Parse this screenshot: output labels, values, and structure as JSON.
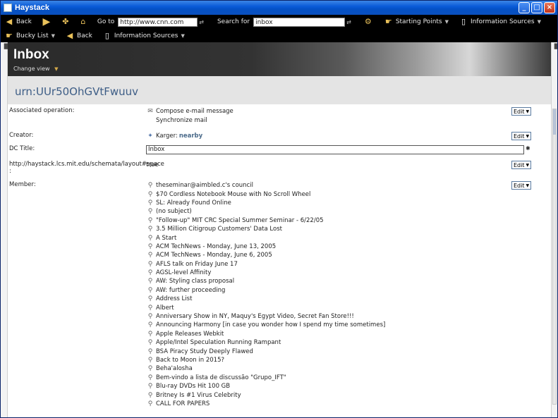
{
  "window": {
    "title": "Haystack"
  },
  "window_controls": {
    "minimize": "_",
    "maximize": "□",
    "close": "×"
  },
  "toolbar1": {
    "back": "Back",
    "go_to_label": "Go to",
    "go_to_value": "http://www.cnn.com",
    "search_label": "Search for",
    "search_value": "inbox",
    "starting_points": "Starting Points",
    "information_sources": "Information Sources"
  },
  "toolbar2": {
    "bucky_list": "Bucky List",
    "back": "Back",
    "information_sources": "Information Sources"
  },
  "header": {
    "title": "Inbox",
    "change_view": "Change view"
  },
  "urn": "urn:UUr50OhGVtFwuuv",
  "properties": {
    "associated_operation": {
      "label": "Associated operation:",
      "values": [
        "Compose e-mail message",
        "Synchronize mail"
      ],
      "edit": "Edit"
    },
    "creator": {
      "label": "Creator:",
      "value_prefix": "Karger: ",
      "value_name": "nearby",
      "edit": "Edit"
    },
    "dc_title": {
      "label": "DC Title:",
      "value": "Inbox"
    },
    "layout_space": {
      "label": "http://haystack.lcs.mit.edu/schemata/layout#space",
      "label_colon": ":",
      "value": "true",
      "edit": "Edit"
    },
    "member": {
      "label": "Member:",
      "edit": "Edit",
      "items": [
        "theseminar@aimbled.c's council",
        "$70 Cordless Notebook Mouse with No Scroll Wheel",
        "SL: Already Found Online",
        "(no subject)",
        "\"Follow-up\" MIT CRC Special Summer Seminar - 6/22/05",
        "3.5 Million Citigroup Customers' Data Lost",
        "A Start",
        "ACM TechNews - Monday, June 13, 2005",
        "ACM TechNews - Monday, June 6, 2005",
        "AFLS talk on Friday June 17",
        "AGSL-level Affinity",
        "AW: Styling class proposal",
        "AW: further proceeding",
        "Address List",
        "Albert",
        "Anniversary Show in NY, Maquy's Egypt Video, Secret Fan Store!!!",
        "Announcing Harmony [in case you wonder how I spend my time sometimes]",
        "Apple Releases Webkit",
        "Apple/Intel Speculation Running Rampant",
        "BSA Piracy Study Deeply Flawed",
        "Back to Moon in 2015?",
        "Beha'alosha",
        "Bem-vindo a lista de discussão \"Grupo_IFT\"",
        "Blu-ray DVDs Hit 100 GB",
        "Britney Is #1 Virus Celebrity",
        "CALL FOR PAPERS"
      ]
    }
  },
  "colors": {
    "titlebar": "#0a5bd8",
    "toolbar_bg": "#000000",
    "urn_text": "#3d5d86",
    "icon_accent": "#d4a94a"
  },
  "icons": {
    "app": "app-icon",
    "back": "back-arrow-icon",
    "forward": "forward-arrow-icon",
    "refresh": "refresh-icon",
    "home": "home-icon",
    "go": "go-icon",
    "search_go": "search-go-icon",
    "starting_points": "starting-points-icon",
    "information_sources": "information-sources-icon",
    "bucky": "bucky-icon",
    "email": "email-icon",
    "person": "person-icon",
    "message": "message-icon"
  }
}
